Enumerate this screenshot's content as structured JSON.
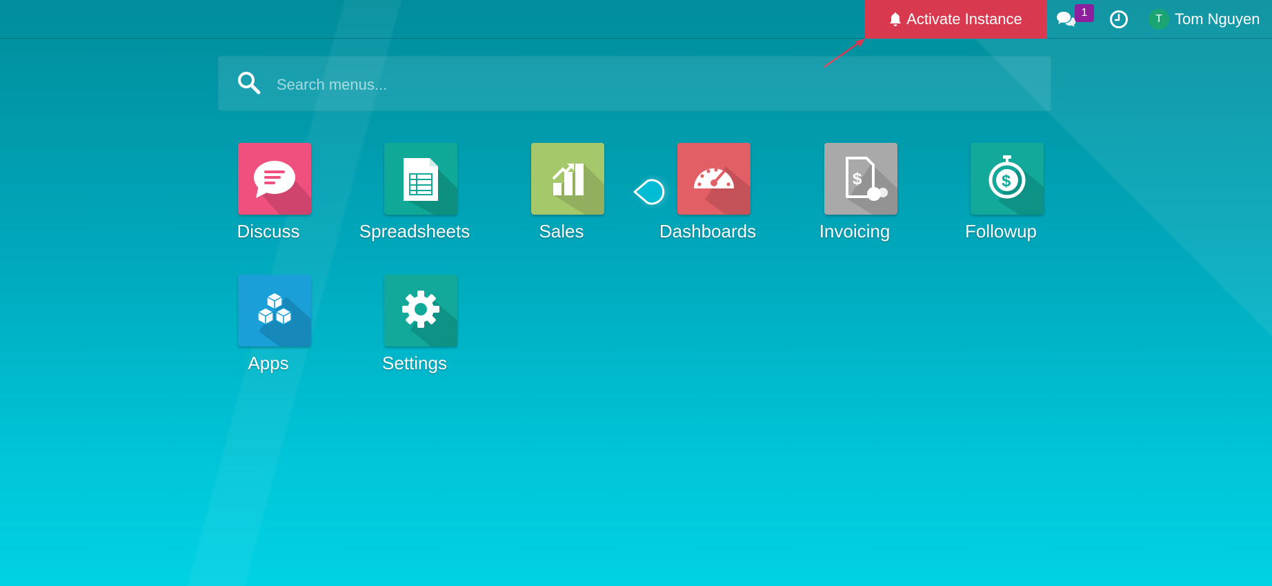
{
  "topbar": {
    "activate_label": "Activate Instance",
    "chat_badge": "1",
    "user_initial": "T",
    "user_name": "Tom Nguyen"
  },
  "search": {
    "placeholder": "Search menus..."
  },
  "apps": [
    {
      "label": "Discuss",
      "color": "#f0507e",
      "icon": "chat-bubble-icon"
    },
    {
      "label": "Spreadsheets",
      "color": "#10a896",
      "icon": "spreadsheet-icon"
    },
    {
      "label": "Sales",
      "color": "#a5c86b",
      "icon": "bar-chart-icon"
    },
    {
      "label": "Dashboards",
      "color": "#e35f66",
      "icon": "speedometer-icon"
    },
    {
      "label": "Invoicing",
      "color": "#a9a9a9",
      "icon": "invoice-icon"
    },
    {
      "label": "Followup",
      "color": "#12a89a",
      "icon": "stopwatch-dollar-icon"
    },
    {
      "label": "Apps",
      "color": "#1a9fd9",
      "icon": "cubes-icon"
    },
    {
      "label": "Settings",
      "color": "#12a89a",
      "icon": "gear-icon"
    }
  ],
  "colors": {
    "accent_red": "#d9394e",
    "badge_purple": "#8e1f9e",
    "avatar_green": "#1aa573"
  }
}
